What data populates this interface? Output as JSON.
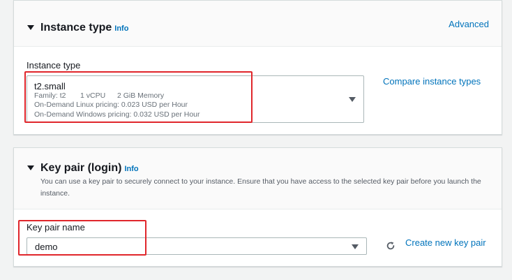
{
  "instance_section": {
    "title": "Instance type",
    "info": "Info",
    "advanced_link": "Advanced",
    "field_label": "Instance type",
    "selected": {
      "name": "t2.small",
      "family": "Family: t2",
      "vcpu": "1 vCPU",
      "memory": "2 GiB Memory",
      "linux_pricing": "On-Demand Linux pricing: 0.023 USD per Hour",
      "windows_pricing": "On-Demand Windows pricing: 0.032 USD per Hour"
    },
    "compare_link": "Compare instance types"
  },
  "keypair_section": {
    "title": "Key pair (login)",
    "info": "Info",
    "description": "You can use a key pair to securely connect to your instance. Ensure that you have access to the selected key pair before you launch the instance.",
    "field_label": "Key pair name",
    "selected": "demo",
    "create_link": "Create new key pair"
  },
  "colors": {
    "link": "#0073bb",
    "highlight": "#e0262b",
    "background": "#f2f3f3"
  },
  "icons": [
    "caret-down-icon",
    "dropdown-arrow-icon",
    "refresh-icon"
  ]
}
